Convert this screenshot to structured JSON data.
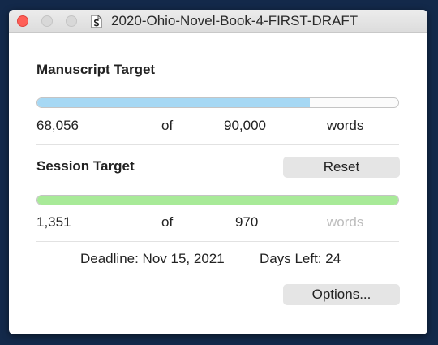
{
  "window": {
    "title": "2020-Ohio-Novel-Book-4-FIRST-DRAFT"
  },
  "manuscript": {
    "heading": "Manuscript Target",
    "current": "68,056",
    "of_label": "of",
    "target": "90,000",
    "unit": "words",
    "progress_fraction": 0.756,
    "bar_color": "#a6d8f4"
  },
  "session": {
    "heading": "Session Target",
    "reset_label": "Reset",
    "current": "1,351",
    "of_label": "of",
    "target": "970",
    "unit": "words",
    "progress_fraction": 1.0,
    "bar_color": "#a8ea98"
  },
  "footer": {
    "deadline": "Deadline: Nov 15, 2021",
    "days_left": "Days Left: 24",
    "options_label": "Options..."
  },
  "colors": {
    "close": "#fe5f57",
    "background": "#13294a"
  },
  "icons": {
    "doc": "scrivener-document-icon"
  }
}
